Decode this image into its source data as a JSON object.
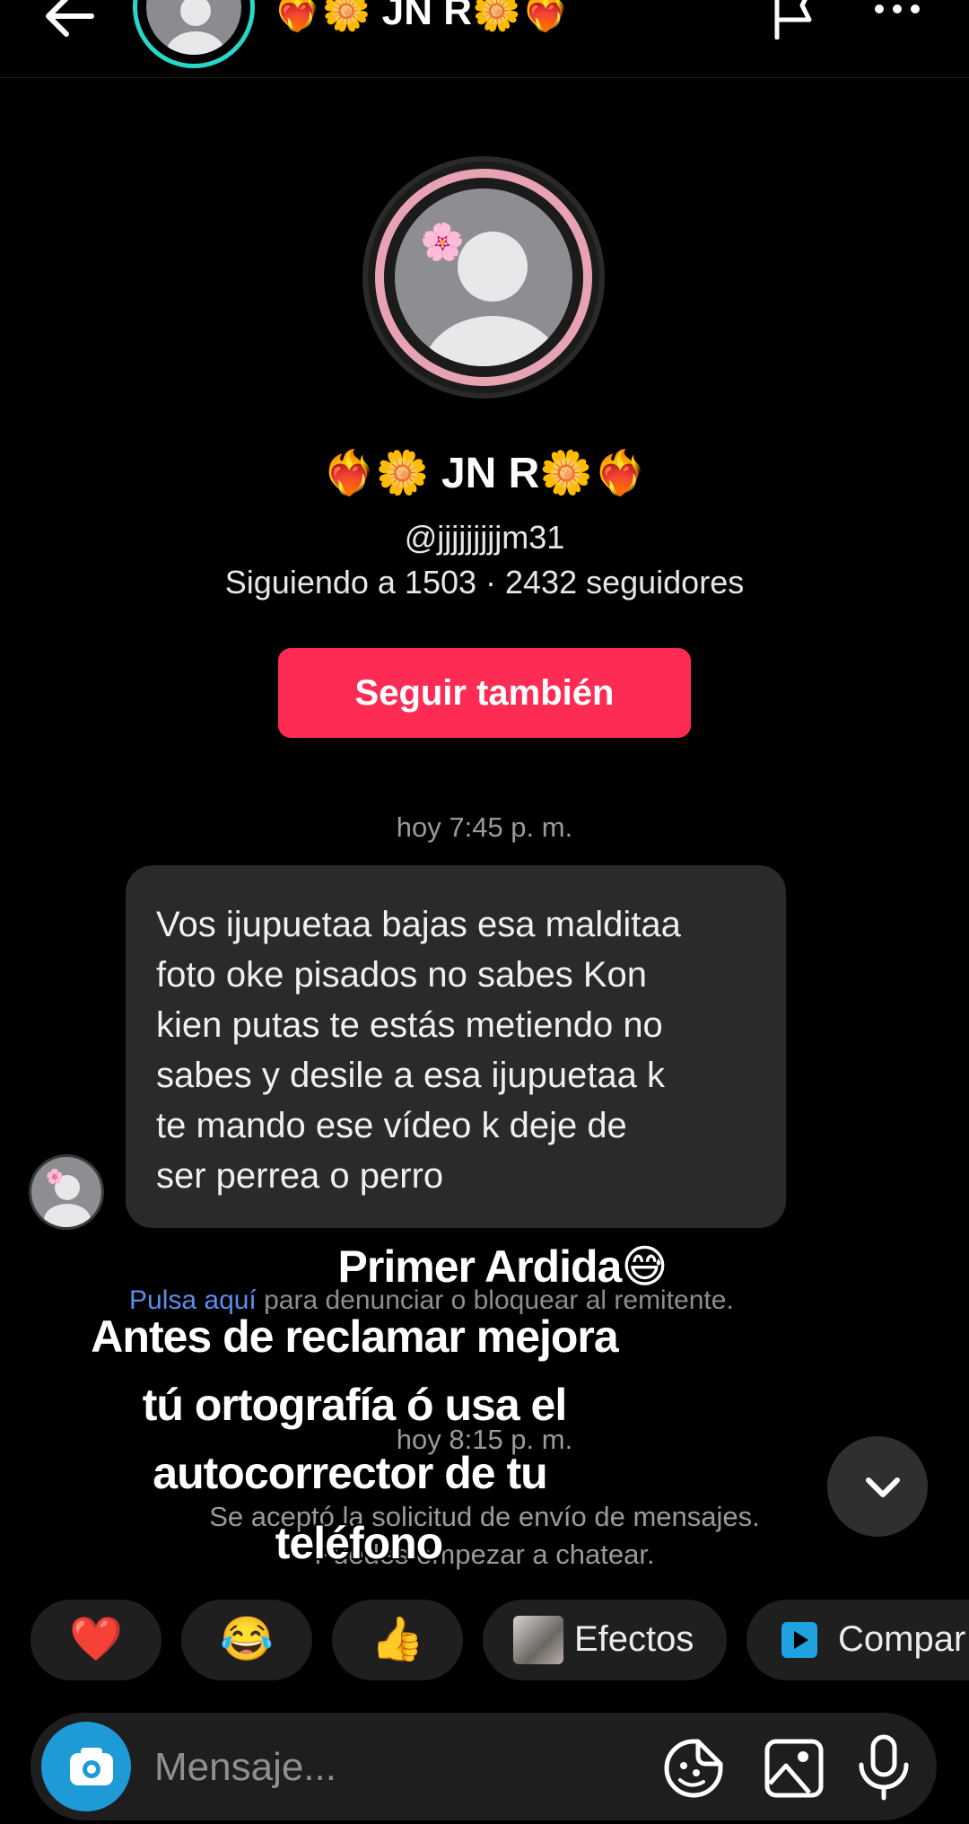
{
  "header": {
    "name": "❤️‍🔥🌼 JN R🌼❤️‍🔥",
    "icons": {
      "back": "arrow-left-icon",
      "report": "flag-icon",
      "more": "more-horizontal-icon"
    },
    "avatar_ring_color": "#28d7c8"
  },
  "profile": {
    "display_name": "❤️‍🔥🌼 JN R🌼❤️‍🔥",
    "username": "@jjjjjjjjjm31",
    "stats": "Siguiendo a 1503 · 2432 seguidores",
    "follow_button": "Seguir también",
    "follow_color": "#fe2c55"
  },
  "chat": {
    "time1": "hoy 7:45 p. m.",
    "message": "Vos ijupuetaa bajas esa malditaa\nfoto oke pisados no sabes Kon\nkien putas te estás metiendo no\nsabes y desile a esa ijupuetaa k\nte mando ese vídeo k deje de\nser perrea o perro",
    "report_link": "Pulsa aquí",
    "report_rest": " para denunciar o bloquear al remitente.",
    "time2": "hoy 8:15 p. m.",
    "system1": "Se aceptó la solicitud de envío de mensajes.",
    "system2": "Puedes empezar a chatear."
  },
  "overlay_caption": {
    "line1": "Primer Ardida😅",
    "line2": "Antes de reclamar mejora",
    "line3": "tú ortografía ó usa el",
    "line4": "autocorrector de tu",
    "line5": "teléfono"
  },
  "quick_actions": {
    "heart": "❤️",
    "laugh": "😂",
    "thumbs_up": "👍",
    "effects_label": "Efectos",
    "share_label": "Compar"
  },
  "composer": {
    "placeholder": "Mensaje...",
    "icons": [
      "camera-icon",
      "sticker-icon",
      "image-icon",
      "microphone-icon"
    ],
    "camera_color": "#1e9bd7"
  }
}
